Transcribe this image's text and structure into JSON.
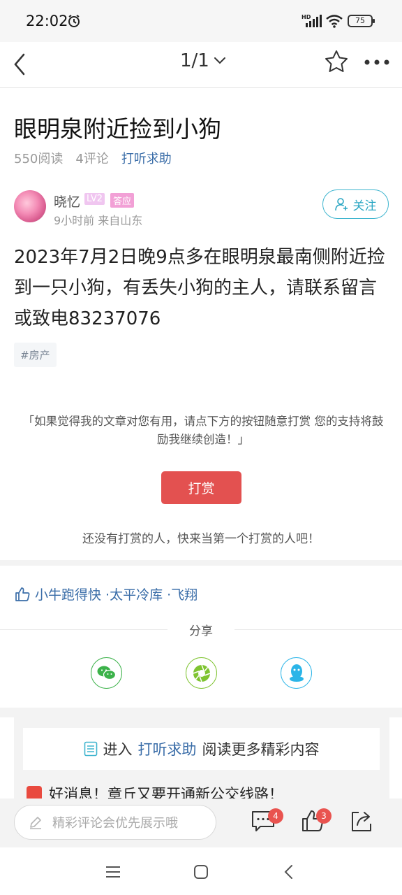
{
  "status": {
    "time": "22:02",
    "battery": "75",
    "network": "HD"
  },
  "nav": {
    "page_indicator": "1/1"
  },
  "post": {
    "title": "眼明泉附近捡到小狗",
    "reads": "550阅读",
    "comments": "4评论",
    "category": "打听求助",
    "author": {
      "name": "晓忆",
      "level": "LV2",
      "badge": "答应",
      "time_location": "9小时前  来自山东"
    },
    "follow_label": "关注",
    "content": "2023年7月2日晚9点多在眼明泉最南侧附近捡到一只小狗，有丢失小狗的主人，请联系留言或致电83237076",
    "topic_tag": "#房产"
  },
  "reward": {
    "prompt": "「如果觉得我的文章对您有用，请点下方的按钮随意打赏 您的支持将鼓励我继续创造！」",
    "button_label": "打赏",
    "empty_text": "还没有打赏的人，快来当第一个打赏的人吧！"
  },
  "likes": {
    "text": "小牛跑得快 ·太平冷库 ·飞翔"
  },
  "share": {
    "title": "分享",
    "targets": [
      "wechat-icon",
      "moments-icon",
      "qq-icon"
    ]
  },
  "more": {
    "prefix": "进入",
    "link": "打听求助",
    "suffix": "阅读更多精彩内容"
  },
  "news": {
    "headline": "好消息！章丘又要开通新公交线路！"
  },
  "comment_bar": {
    "placeholder": "精彩评论会优先展示哦",
    "comment_count": "4",
    "like_count": "3"
  },
  "colors": {
    "accent_blue": "#3a6da8",
    "follow_teal": "#29a6c3",
    "reward_red": "#e35150",
    "badge_red": "#e9534f"
  }
}
